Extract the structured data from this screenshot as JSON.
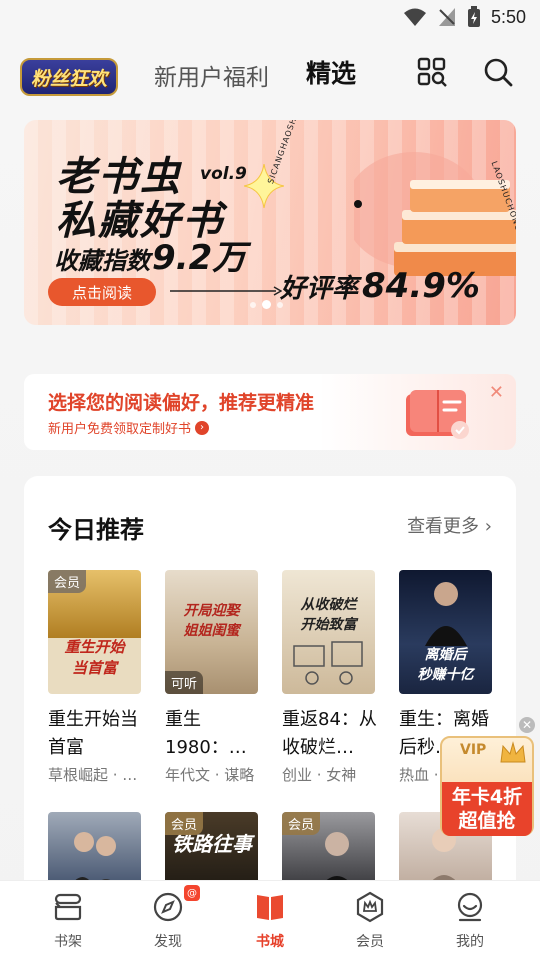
{
  "status_bar": {
    "time": "5:50"
  },
  "header": {
    "logo_text": "粉丝狂欢",
    "tabs": [
      {
        "label": "新用户福利",
        "selected": false
      },
      {
        "label": "精选",
        "selected": true
      }
    ],
    "icons": [
      "grid-search-icon",
      "search-icon"
    ]
  },
  "banner": {
    "title_line1": "老书虫",
    "title_line2": "私藏好书",
    "vol": "vol.9",
    "collect_label": "收藏指数",
    "collect_value": "9.2万",
    "read_button": "点击阅读",
    "rate_label": "好评率",
    "rate_value": "84.9%",
    "side_text_1": "LAOSHUCHONG",
    "side_text_2": "SICANGHAOSHU",
    "slides": 3,
    "active_slide": 1
  },
  "preference": {
    "title": "选择您的阅读偏好，推荐更精准",
    "subtitle": "新用户免费领取定制好书"
  },
  "recommend": {
    "title": "今日推荐",
    "more": "查看更多",
    "books": [
      {
        "title": "重生开始当首富",
        "tags": "草根崛起 · …",
        "badge": "会员",
        "tag": "",
        "cover_text": "重生开始\n当首富",
        "cover_color": "#c79a3a"
      },
      {
        "title": "重生1980：…",
        "tags": "年代文 · 谋略",
        "badge": "",
        "tag": "可听",
        "cover_text": "开局迎娶\n姐姐闺蜜",
        "cover_color": "#d8c6a8"
      },
      {
        "title": "重返84：从收破烂…",
        "tags": "创业 · 女神",
        "badge": "",
        "tag": "",
        "cover_text": "从收破烂\n开始致富",
        "cover_color": "#cdb99a"
      },
      {
        "title": "重生：离婚后秒…",
        "tags": "热血 · …",
        "badge": "",
        "tag": "",
        "cover_text": "离婚后\n秒赚十亿",
        "cover_color": "#1f2b48"
      },
      {
        "title": "",
        "tags": "",
        "badge": "",
        "tag": "",
        "cover_text": "",
        "cover_color": "#3a4a66"
      },
      {
        "title": "",
        "tags": "",
        "badge": "会员",
        "tag": "",
        "cover_text": "铁路往事",
        "cover_color": "#2b2620"
      },
      {
        "title": "",
        "tags": "",
        "badge": "会员",
        "tag": "",
        "cover_text": "",
        "cover_color": "#4a4a4e"
      },
      {
        "title": "",
        "tags": "",
        "badge": "",
        "tag": "",
        "cover_text": "",
        "cover_color": "#c9b6a6"
      }
    ]
  },
  "vip_float": {
    "badge": "VIP",
    "line1": "年卡4折",
    "line2": "超值抢"
  },
  "bottom_nav": [
    {
      "label": "书架",
      "icon": "bookshelf-icon",
      "active": false
    },
    {
      "label": "发现",
      "icon": "compass-icon",
      "active": false,
      "badge": "@"
    },
    {
      "label": "书城",
      "icon": "bookstore-icon",
      "active": true
    },
    {
      "label": "会员",
      "icon": "member-crown-icon",
      "active": false
    },
    {
      "label": "我的",
      "icon": "profile-icon",
      "active": false
    }
  ]
}
